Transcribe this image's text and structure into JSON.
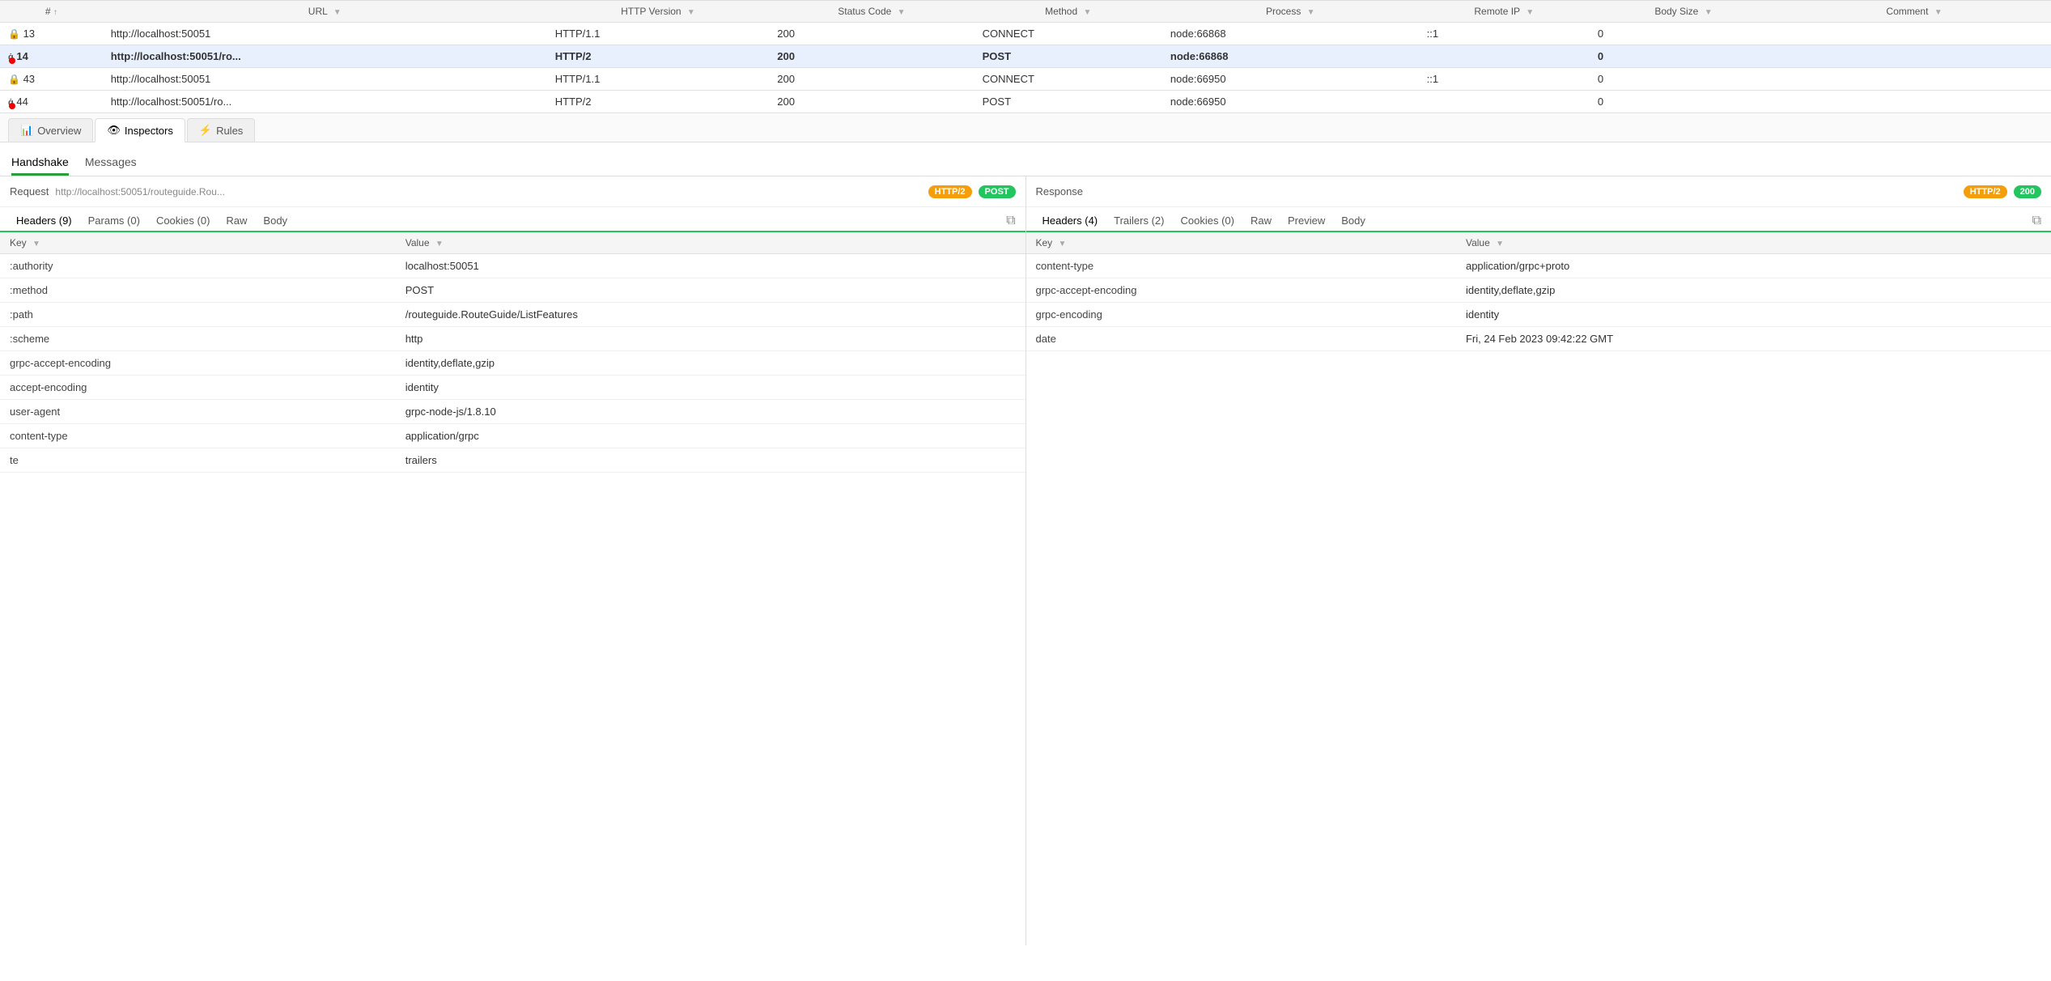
{
  "columns": [
    {
      "id": "num",
      "label": "#",
      "sortable": true
    },
    {
      "id": "url",
      "label": "URL",
      "filterable": true
    },
    {
      "id": "http",
      "label": "HTTP Version",
      "filterable": true
    },
    {
      "id": "status",
      "label": "Status Code",
      "filterable": true
    },
    {
      "id": "method",
      "label": "Method",
      "filterable": true
    },
    {
      "id": "process",
      "label": "Process",
      "filterable": true
    },
    {
      "id": "ip",
      "label": "Remote IP",
      "filterable": true
    },
    {
      "id": "body",
      "label": "Body Size",
      "filterable": true
    },
    {
      "id": "comment",
      "label": "Comment",
      "filterable": true
    }
  ],
  "rows": [
    {
      "num": "13",
      "icon": "lock",
      "url": "http://localhost:50051",
      "http": "HTTP/1.1",
      "status": "200",
      "method": "CONNECT",
      "process": "node:66868",
      "ip": "::1",
      "body": "0",
      "comment": "",
      "selected": false
    },
    {
      "num": "14",
      "icon": "grpc",
      "url": "http://localhost:50051/ro...",
      "http": "HTTP/2",
      "status": "200",
      "method": "POST",
      "process": "node:66868",
      "ip": "",
      "body": "0",
      "comment": "",
      "selected": true
    },
    {
      "num": "43",
      "icon": "lock",
      "url": "http://localhost:50051",
      "http": "HTTP/1.1",
      "status": "200",
      "method": "CONNECT",
      "process": "node:66950",
      "ip": "::1",
      "body": "0",
      "comment": "",
      "selected": false
    },
    {
      "num": "44",
      "icon": "grpc",
      "url": "http://localhost:50051/ro...",
      "http": "HTTP/2",
      "status": "200",
      "method": "POST",
      "process": "node:66950",
      "ip": "",
      "body": "0",
      "comment": "",
      "selected": false
    }
  ],
  "tabs": [
    {
      "id": "overview",
      "label": "Overview",
      "icon": "chart"
    },
    {
      "id": "inspectors",
      "label": "Inspectors",
      "icon": "eye"
    },
    {
      "id": "rules",
      "label": "Rules",
      "icon": "lightning"
    }
  ],
  "activeTab": "inspectors",
  "handshakeTabs": [
    {
      "id": "handshake",
      "label": "Handshake"
    },
    {
      "id": "messages",
      "label": "Messages"
    }
  ],
  "activeHandshakeTab": "handshake",
  "request": {
    "label": "Request",
    "url": "http://localhost:50051/routeguide.Rou...",
    "badge_http": "HTTP/2",
    "badge_method": "POST",
    "tabs": [
      {
        "id": "headers",
        "label": "Headers (9)"
      },
      {
        "id": "params",
        "label": "Params (0)"
      },
      {
        "id": "cookies",
        "label": "Cookies (0)"
      },
      {
        "id": "raw",
        "label": "Raw"
      },
      {
        "id": "body",
        "label": "Body"
      }
    ],
    "activeTab": "headers",
    "headers": [
      {
        "key": ":authority",
        "value": "localhost:50051"
      },
      {
        "key": ":method",
        "value": "POST"
      },
      {
        "key": ":path",
        "value": "/routeguide.RouteGuide/ListFeatures"
      },
      {
        "key": ":scheme",
        "value": "http"
      },
      {
        "key": "grpc-accept-encoding",
        "value": "identity,deflate,gzip"
      },
      {
        "key": "accept-encoding",
        "value": "identity"
      },
      {
        "key": "user-agent",
        "value": "grpc-node-js/1.8.10"
      },
      {
        "key": "content-type",
        "value": "application/grpc"
      },
      {
        "key": "te",
        "value": "trailers"
      }
    ]
  },
  "response": {
    "label": "Response",
    "badge_http": "HTTP/2",
    "badge_status": "200",
    "tabs": [
      {
        "id": "headers",
        "label": "Headers (4)"
      },
      {
        "id": "trailers",
        "label": "Trailers (2)"
      },
      {
        "id": "cookies",
        "label": "Cookies (0)"
      },
      {
        "id": "raw",
        "label": "Raw"
      },
      {
        "id": "preview",
        "label": "Preview"
      },
      {
        "id": "body",
        "label": "Body"
      }
    ],
    "activeTab": "headers",
    "headers": [
      {
        "key": "content-type",
        "value": "application/grpc+proto"
      },
      {
        "key": "grpc-accept-encoding",
        "value": "identity,deflate,gzip"
      },
      {
        "key": "grpc-encoding",
        "value": "identity"
      },
      {
        "key": "date",
        "value": "Fri, 24 Feb 2023 09:42:22 GMT"
      }
    ]
  }
}
